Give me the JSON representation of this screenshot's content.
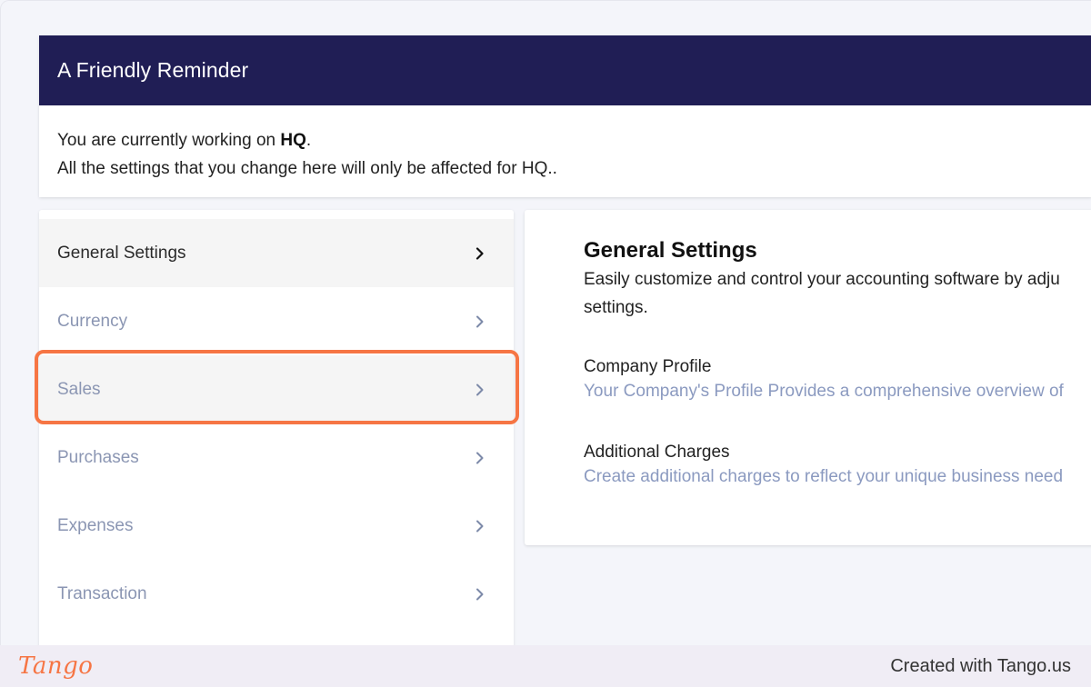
{
  "reminder": {
    "title": "A Friendly Reminder",
    "line1_prefix": "You are currently working on ",
    "line1_bold": "HQ",
    "line1_suffix": ".",
    "line2": "All the settings that you change here will only be affected for HQ.."
  },
  "menu": {
    "items": [
      {
        "label": "General Settings",
        "active": true
      },
      {
        "label": "Currency"
      },
      {
        "label": "Sales",
        "highlighted": true
      },
      {
        "label": "Purchases"
      },
      {
        "label": "Expenses"
      },
      {
        "label": "Transaction"
      }
    ]
  },
  "content": {
    "title": "General Settings",
    "description": "Easily customize and control your accounting software by adju settings.",
    "description_line1": "Easily customize and control your accounting software by adju",
    "description_line2": "settings.",
    "sections": [
      {
        "title": "Company Profile",
        "description": "Your Company's Profile Provides a comprehensive overview of"
      },
      {
        "title": "Additional Charges",
        "description": "Create additional charges to reflect your unique business need"
      }
    ]
  },
  "footer": {
    "logo": "Tango",
    "credit": "Created with Tango.us"
  },
  "colors": {
    "header_bg": "#201e55",
    "highlight": "#f67544",
    "muted_text": "#8b96b3"
  },
  "icons": {
    "chevron": "chevron-right-icon"
  }
}
